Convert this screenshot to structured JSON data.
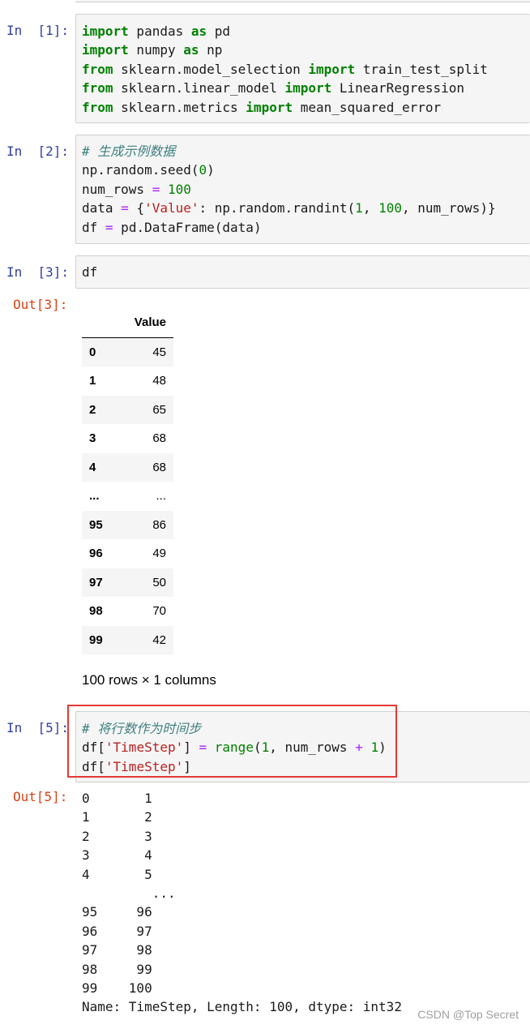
{
  "cells": [
    {
      "prompt": "In  [1]:",
      "lines": [
        [
          {
            "t": "import",
            "c": "kw"
          },
          {
            "t": " pandas "
          },
          {
            "t": "as",
            "c": "kw"
          },
          {
            "t": " pd"
          }
        ],
        [
          {
            "t": "import",
            "c": "kw"
          },
          {
            "t": " numpy "
          },
          {
            "t": "as",
            "c": "kw"
          },
          {
            "t": " np"
          }
        ],
        [
          {
            "t": "from",
            "c": "kw"
          },
          {
            "t": " sklearn.model_selection "
          },
          {
            "t": "import",
            "c": "kw"
          },
          {
            "t": " train_test_split"
          }
        ],
        [
          {
            "t": "from",
            "c": "kw"
          },
          {
            "t": " sklearn.linear_model "
          },
          {
            "t": "import",
            "c": "kw"
          },
          {
            "t": " LinearRegression"
          }
        ],
        [
          {
            "t": "from",
            "c": "kw"
          },
          {
            "t": " sklearn.metrics "
          },
          {
            "t": "import",
            "c": "kw"
          },
          {
            "t": " mean_squared_error"
          }
        ]
      ]
    },
    {
      "prompt": "In  [2]:",
      "lines": [
        [
          {
            "t": "# 生成示例数据",
            "c": "cm"
          }
        ],
        [
          {
            "t": "np.random.seed("
          },
          {
            "t": "0",
            "c": "num"
          },
          {
            "t": ")"
          }
        ],
        [
          {
            "t": "num_rows "
          },
          {
            "t": "=",
            "c": "op"
          },
          {
            "t": " "
          },
          {
            "t": "100",
            "c": "num"
          }
        ],
        [
          {
            "t": "data "
          },
          {
            "t": "=",
            "c": "op"
          },
          {
            "t": " {"
          },
          {
            "t": "'Value'",
            "c": "str"
          },
          {
            "t": ": np.random.randint("
          },
          {
            "t": "1",
            "c": "num"
          },
          {
            "t": ", "
          },
          {
            "t": "100",
            "c": "num"
          },
          {
            "t": ", num_rows)}"
          }
        ],
        [
          {
            "t": "df "
          },
          {
            "t": "=",
            "c": "op"
          },
          {
            "t": " pd.DataFrame(data)"
          }
        ]
      ]
    },
    {
      "prompt": "In  [3]:",
      "lines": [
        [
          {
            "t": "df"
          }
        ]
      ]
    },
    {
      "prompt": "In  [5]:",
      "lines": [
        [
          {
            "t": "# 将行数作为时间步",
            "c": "cm"
          }
        ],
        [
          {
            "t": "df["
          },
          {
            "t": "'TimeStep'",
            "c": "str"
          },
          {
            "t": "] "
          },
          {
            "t": "=",
            "c": "op"
          },
          {
            "t": " "
          },
          {
            "t": "range",
            "c": "fn"
          },
          {
            "t": "("
          },
          {
            "t": "1",
            "c": "num"
          },
          {
            "t": ", num_rows "
          },
          {
            "t": "+",
            "c": "op"
          },
          {
            "t": " "
          },
          {
            "t": "1",
            "c": "num"
          },
          {
            "t": ")"
          }
        ],
        [
          {
            "t": "df["
          },
          {
            "t": "'TimeStep'",
            "c": "str"
          },
          {
            "t": "]"
          }
        ]
      ]
    }
  ],
  "out3": {
    "prompt": "Out[3]:",
    "column": "Value",
    "rows": [
      {
        "idx": "0",
        "val": "45"
      },
      {
        "idx": "1",
        "val": "48"
      },
      {
        "idx": "2",
        "val": "65"
      },
      {
        "idx": "3",
        "val": "68"
      },
      {
        "idx": "4",
        "val": "68"
      },
      {
        "idx": "...",
        "val": "..."
      },
      {
        "idx": "95",
        "val": "86"
      },
      {
        "idx": "96",
        "val": "49"
      },
      {
        "idx": "97",
        "val": "50"
      },
      {
        "idx": "98",
        "val": "70"
      },
      {
        "idx": "99",
        "val": "42"
      }
    ],
    "shape_text": "100 rows × 1 columns"
  },
  "out5": {
    "prompt": "Out[5]:",
    "lines": [
      "0       1",
      "1       2",
      "2       3",
      "3       4",
      "4       5",
      "         ...",
      "95     96",
      "96     97",
      "97     98",
      "98     99",
      "99    100",
      "Name: TimeStep, Length: 100, dtype: int32"
    ]
  },
  "watermark": "CSDN @Top Secret"
}
